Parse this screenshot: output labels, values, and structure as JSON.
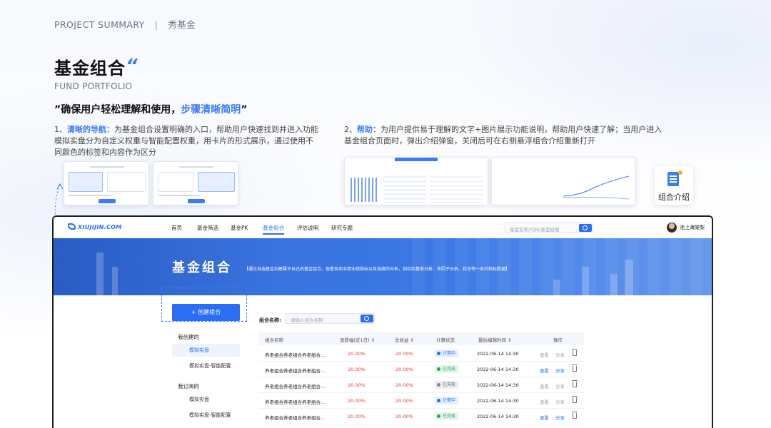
{
  "header": {
    "project": "PROJECT SUMMARY",
    "separator": "|",
    "name": "秀基金"
  },
  "title": "基金组合",
  "title_quote": "“",
  "subtitle": "FUND PORTFOLIO",
  "tagline": {
    "quote_open": "”",
    "text": "确保用户轻松理解和使用，",
    "highlight": "步骤清晰简明",
    "quote_close": "”"
  },
  "points": [
    {
      "index": "1、",
      "key": "清晰的导航",
      "text": "：为基金组合设置明确的入口，帮助用户快速找到并进入功能模拟实盘分为自定义权重与智能配置权重，用卡片的形式展示，通过使用不同颜色的标签和内容作为区分"
    },
    {
      "index": "2、",
      "key": "帮助",
      "text": "：为用户提供易于理解的文字+图片展示功能说明，帮助用户快速了解；当用户进入基金组合页面时，弹出介绍弹窗，关闭后可在右侧悬浮组合介绍重新打开"
    }
  ],
  "help_card": {
    "label": "组合介绍",
    "icon": "document-icon"
  },
  "app": {
    "logo": "XIUJIJIN.COM",
    "nav": [
      "首页",
      "基金筛选",
      "基金PK",
      "基金组合",
      "评估说明",
      "研究专题"
    ],
    "active_nav": "基金组合",
    "search_placeholder": "基金名称/代码/基金经理",
    "user": "池上海棠梨",
    "banner_title": "基金组合",
    "banner_desc": "【通过自选基金创建属于自己的基金组合，查看各项业绩业绩指标以及深度的分析，如实际基准分析、多因子分析、持仓等一系列指标数据】",
    "create_button": "+ 创建组合",
    "groups": [
      {
        "title": "我创建的",
        "items": [
          "模拟实盘",
          "模拟实盘-智能配置"
        ]
      },
      {
        "title": "我订阅的",
        "items": [
          "模拟实盘",
          "模拟实盘-智能配置"
        ]
      }
    ],
    "filter_label": "组合名称:",
    "filter_placeholder": "请输入组合名称",
    "table": {
      "headers": [
        "组合名称",
        "涨跌幅(近1日) ⇕",
        "总收益 ⇕",
        "计算状态",
        "最后编辑时间 ⇕",
        "操作"
      ],
      "rows": [
        {
          "name": "养老组合养老组合养老组合...",
          "change": "20.00%",
          "total": "20.00%",
          "status": "计算中",
          "status_type": "blue",
          "time": "2022-06-14 14:30",
          "view": "查看",
          "share": "分享"
        },
        {
          "name": "养老组合养老组合养老组合...",
          "change": "20.00%",
          "total": "20.00%",
          "status": "已完成",
          "status_type": "green",
          "time": "2022-06-14 14:30",
          "view": "查看",
          "share": "分享"
        },
        {
          "name": "养老组合养老组合养老组合...",
          "change": "20.00%",
          "total": "20.00%",
          "status": "已失败",
          "status_type": "grey",
          "time": "2022-06-14 14:30",
          "view": "查看",
          "share": "分享"
        },
        {
          "name": "养老组合养老组合养老组合...",
          "change": "20.00%",
          "total": "20.00%",
          "status": "计算中",
          "status_type": "blue",
          "time": "2022-06-14 14:30",
          "view": "查看",
          "share": "分享"
        },
        {
          "name": "养老组合养老组合养老组合...",
          "change": "20.00%",
          "total": "20.00%",
          "status": "已完成",
          "status_type": "green",
          "time": "2022-06-14 14:30",
          "view": "查看",
          "share": "分享"
        }
      ]
    }
  },
  "colors": {
    "accent": "#3c7bf6",
    "red": "#e23a3a",
    "green": "#23a455",
    "banner": "#3b79e6"
  }
}
